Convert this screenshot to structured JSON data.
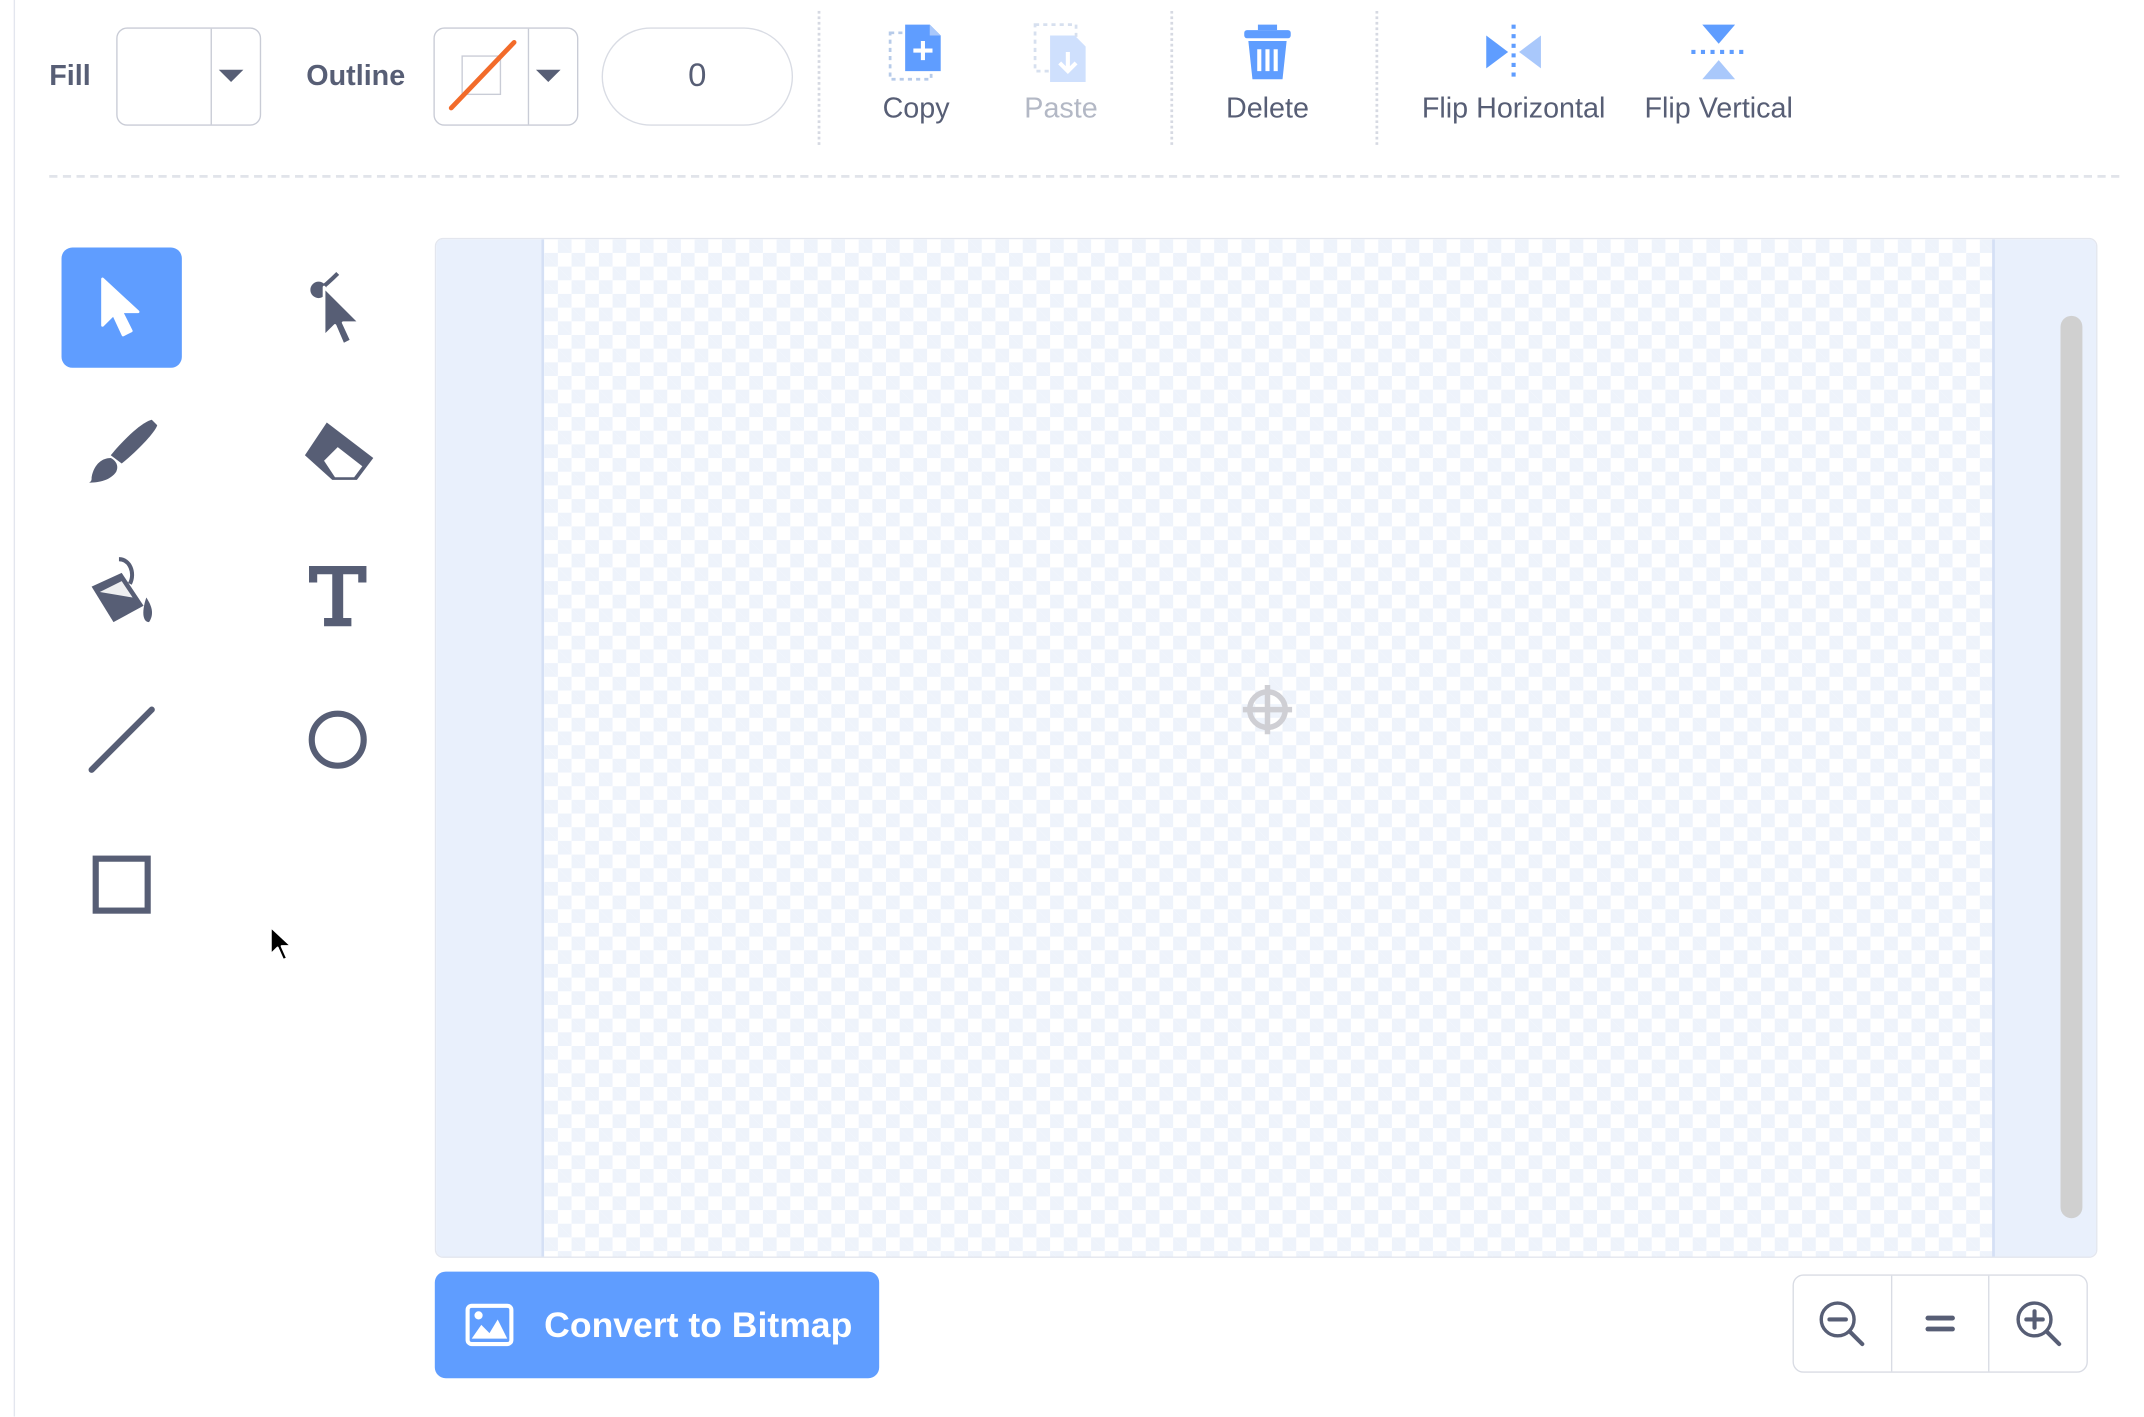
{
  "toolbar": {
    "fill_label": "Fill",
    "outline_label": "Outline",
    "stroke_width_value": "0",
    "copy_label": "Copy",
    "paste_label": "Paste",
    "delete_label": "Delete",
    "flip_horizontal_label": "Flip Horizontal",
    "flip_vertical_label": "Flip Vertical"
  },
  "tools": [
    {
      "name": "select",
      "icon": "arrow-select-icon",
      "selected": true
    },
    {
      "name": "reshape",
      "icon": "reshape-icon",
      "selected": false
    },
    {
      "name": "brush",
      "icon": "brush-icon",
      "selected": false
    },
    {
      "name": "eraser",
      "icon": "eraser-icon",
      "selected": false
    },
    {
      "name": "fill",
      "icon": "paint-bucket-icon",
      "selected": false
    },
    {
      "name": "text",
      "icon": "text-icon",
      "selected": false
    },
    {
      "name": "line",
      "icon": "line-icon",
      "selected": false
    },
    {
      "name": "circle",
      "icon": "circle-icon",
      "selected": false
    },
    {
      "name": "rectangle",
      "icon": "rectangle-icon",
      "selected": false
    }
  ],
  "bottom": {
    "convert_label": "Convert to Bitmap",
    "zoom_out_icon": "zoom-out-icon",
    "zoom_reset_icon": "zoom-reset-icon",
    "zoom_in_icon": "zoom-in-icon"
  },
  "colors": {
    "accent": "#5f9dff",
    "text": "#575e75",
    "disabled_text": "#b3b8c5",
    "no_outline_slash": "#f26b2a"
  }
}
